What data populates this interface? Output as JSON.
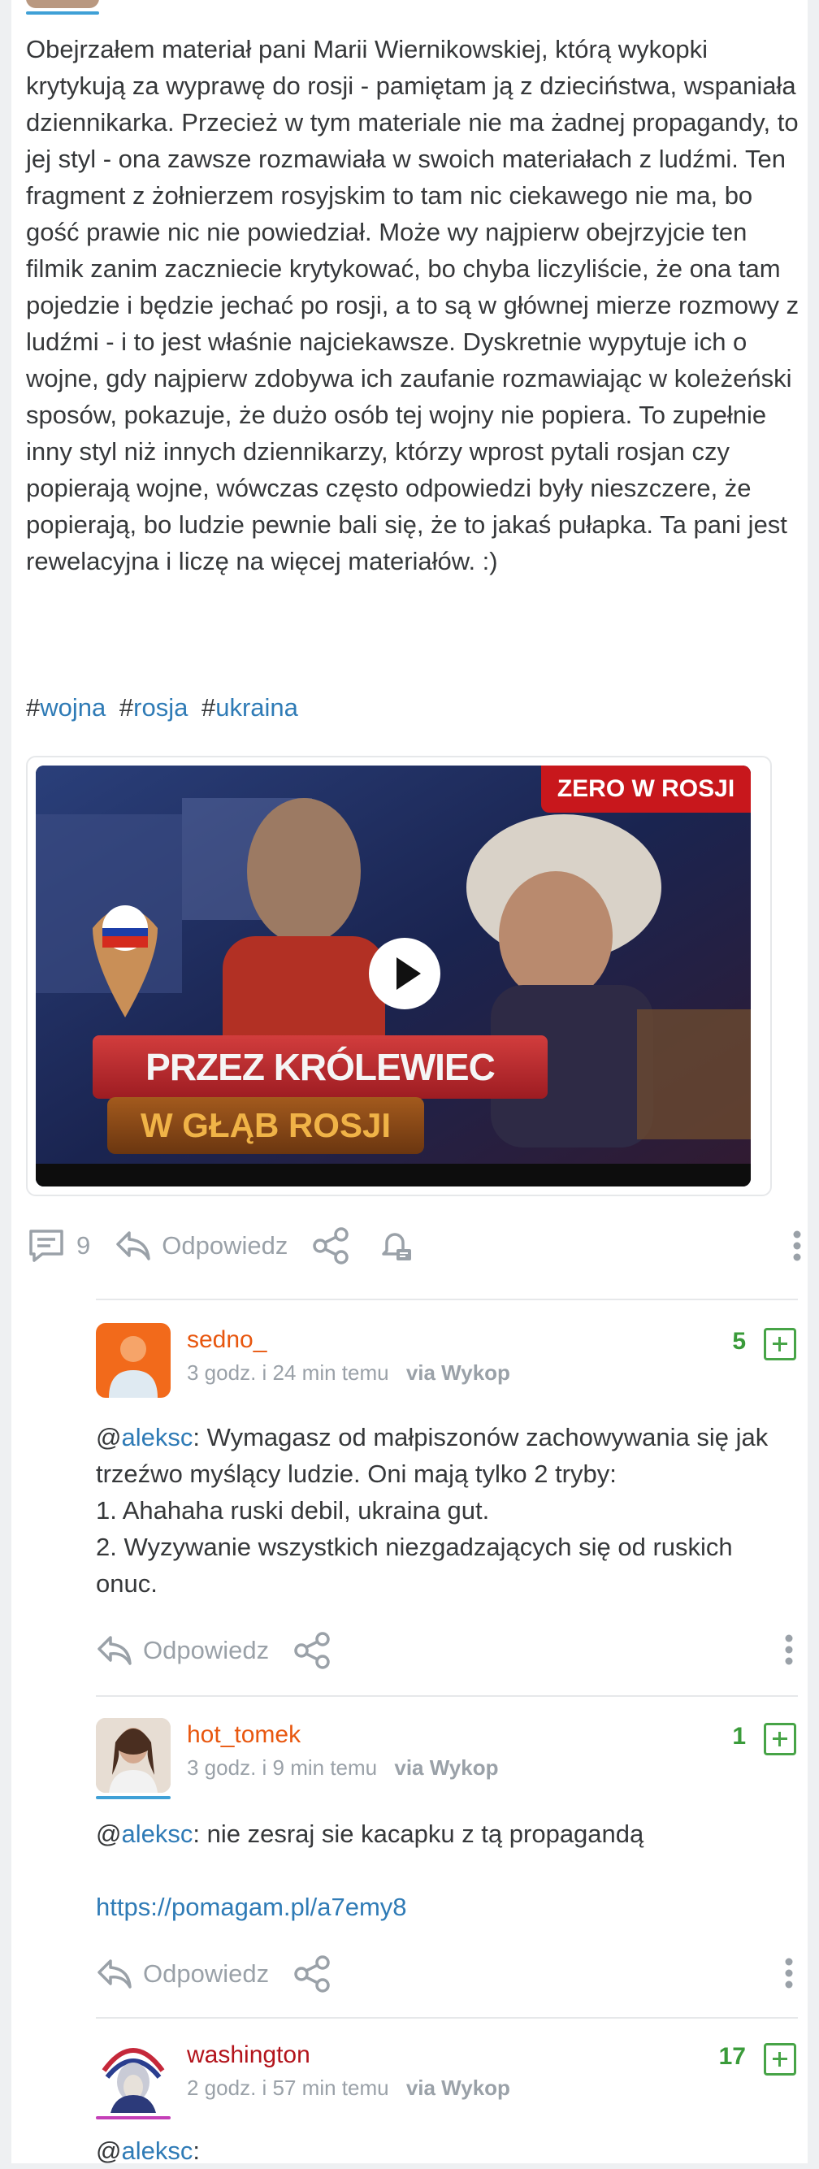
{
  "post": {
    "paragraph": "Obejrzałem materiał pani Marii Wiernikowskiej, którą wykopki krytykują za wyprawę do rosji - pamiętam ją z dzieciństwa, wspaniała dziennikarka. Przecież w tym materiale nie ma żadnej propagandy, to jej styl - ona zawsze rozmawiała w swoich materiałach z ludźmi. Ten fragment z żołnierzem rosyjskim to tam nic ciekawego nie ma, bo gość prawie nic nie powiedział. Może wy najpierw obejrzyjcie ten filmik zanim zaczniecie krytykować, bo chyba liczyliście, że ona tam pojedzie i będzie jechać po rosji, a to są w głównej mierze rozmowy z ludźmi - i to jest właśnie najciekawsze. Dyskretnie wypytuje ich o wojne, gdy najpierw zdobywa ich zaufanie rozmawiając w koleżeński sposów, pokazuje, że dużo osób tej wojny nie popiera. To zupełnie inny styl niż innych dziennikarzy, którzy wprost pytali rosjan czy popierają wojne, wówczas często odpowiedzi były nieszczere, że popierają, bo ludzie pewnie bali się, że to jakaś pułapka. Ta pani jest rewelacyjna i liczę na więcej materiałów. :)",
    "tags": [
      "wojna",
      "rosja",
      "ukraina"
    ],
    "tag_prefix": "#",
    "video": {
      "badge": "ZERO W ROSJI",
      "line1": "PRZEZ KRÓLEWIEC",
      "line2": "W GŁĄB ROSJI"
    },
    "actions": {
      "comments_count": "9",
      "reply_label": "Odpowiedz"
    }
  },
  "comments": [
    {
      "author": "sedno_",
      "author_color": "#e8570f",
      "time": "3 godz. i 24 min temu",
      "via": "via Wykop",
      "score": "5",
      "mention": "aleksc",
      "lines": [
        "Wymagasz od małpiszonów zachowywania się jak trzeźwo myślący ludzie. Oni mają tylko 2 tryby:",
        "1. Ahahaha ruski debil, ukraina gut.",
        "2. Wyzywanie wszystkich niezgadzających się od ruskich onuc."
      ],
      "reply_label": "Odpowiedz"
    },
    {
      "author": "hot_tomek",
      "author_color": "#e8570f",
      "time": "3 godz. i 9 min temu",
      "via": "via Wykop",
      "score": "1",
      "mention": "aleksc",
      "text": "nie zesraj sie kacapku z tą propagandą",
      "link": "https://pomagam.pl/a7emy8",
      "reply_label": "Odpowiedz"
    },
    {
      "author": "washington",
      "author_color": "#b3141c",
      "time": "2 godz. i 57 min temu",
      "via": "via Wykop",
      "score": "17",
      "mention": "aleksc",
      "text": ""
    }
  ],
  "colors": {
    "link": "#2f7bb6",
    "score_green": "#3a9b3a",
    "muted": "#9aa1a8"
  }
}
